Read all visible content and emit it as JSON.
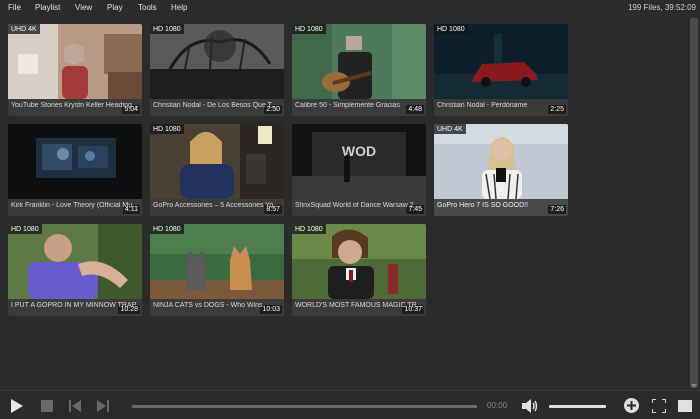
{
  "menu": {
    "file": "File",
    "playlist": "Playlist",
    "view": "View",
    "play": "Play",
    "tools": "Tools",
    "help": "Help"
  },
  "status": "199 Files, 39:52:09",
  "videos": [
    {
      "quality": "UHD 4K",
      "duration": "5:04",
      "title": "YouTube Stories   Krystn Keller   Heading Home Inspiration Playlist"
    },
    {
      "quality": "HD 1080",
      "duration": "2:50",
      "title": "Christian Nodal - De Los Besos Que Te Di"
    },
    {
      "quality": "HD 1080",
      "duration": "4:48",
      "title": "Calibre 50 - Simplemente Gracias"
    },
    {
      "quality": "HD 1080",
      "duration": "2:25",
      "title": "Christian Nodal - Perdóname"
    },
    {
      "quality": "",
      "duration": "4:11",
      "title": "Kirk Franklin - Love Theory (Official Music Video)"
    },
    {
      "quality": "HD 1080",
      "duration": "8:57",
      "title": "GoPro Accessories – 5 Accessories You Need"
    },
    {
      "quality": "",
      "duration": "7:45",
      "title": "SfinxSquad   World of Dance   Warsaw 2019"
    },
    {
      "quality": "UHD 4K",
      "duration": "7:26",
      "title": "GoPro Hero 7 IS SO GOOD!!"
    },
    {
      "quality": "HD 1080",
      "duration": "10:28",
      "title": "I PUT A GOPRO IN MY MINNOW TRAP"
    },
    {
      "quality": "HD 1080",
      "duration": "10:03",
      "title": "NINJA CATS vs DOGS - Who Wins"
    },
    {
      "quality": "HD 1080",
      "duration": "10:37",
      "title": "WORLD'S MOST FAMOUS MAGIC TRICK"
    }
  ],
  "player": {
    "time": "00:00"
  }
}
